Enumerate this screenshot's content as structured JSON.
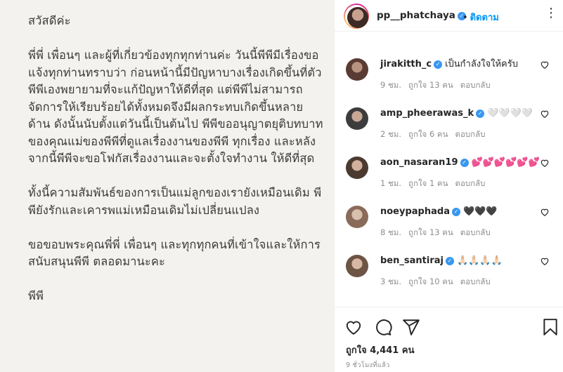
{
  "letter": {
    "paragraphs": [
      "สวัสดีค่ะ",
      "พี่พี่ เพื่อนๆ และผู้ที่เกี่ยวข้องทุกทุกท่านค่ะ วันนี้พีพีมีเรื่องขอแจ้งทุกท่านทราบว่า ก่อนหน้านี้มีปัญหาบางเรื่องเกิดขึ้นที่ตัวพีพีเองพยายามที่จะแก้ปัญหาให้ดีที่สุด แต่พีพีไม่สามารถจัดการให้เรียบร้อยได้ทั้งหมดจึงมีผลกระทบเกิดขึ้นหลายด้าน ดังนั้นนับตั้งแต่วันนี้เป็นต้นไป พีพีขออนุญาตยุติบทบาทของคุณแม่ของพีพีที่ดูแลเรื่องงานของพีพี ทุกเรื่อง และหลังจากนี้พีพีจะขอโฟกัสเรื่องงานและจะตั้งใจทำงาน ให้ดีที่สุด",
      "ทั้งนี้ความสัมพันธ์ของการเป็นแม่ลูกของเรายังเหมือนเดิม พีพียังรักและเคารพแม่เหมือนเดิมไม่เปลี่ยนแปลง",
      "ขอขอบพระคุณพี่พี่ เพื่อนๆ และทุกทุกคนที่เข้าใจและให้การสนับสนุนพีพี ตลอดมานะคะ",
      "พีพี"
    ]
  },
  "header": {
    "username": "pp__phatchaya",
    "verified_mark": "✓",
    "dot": "•",
    "follow_label": "ติดตาม",
    "more_icon": "⋮"
  },
  "comments": [
    {
      "username": "jirakitth_c",
      "verified": true,
      "text": "เป็นกำลังใจให้ครับ",
      "time": "9 ชม.",
      "likes": "ถูกใจ 13 คน",
      "reply": "ตอบกลับ",
      "avatar_color": "#5a3b33"
    },
    {
      "username": "amp_pheerawas_k",
      "verified": true,
      "text": "🤍🤍🤍🤍",
      "time": "2 ชม.",
      "likes": "ถูกใจ 6 คน",
      "reply": "ตอบกลับ",
      "avatar_color": "#3c3c3c"
    },
    {
      "username": "aon_nasaran19",
      "verified": true,
      "text": "💕💕💕💕💕💕",
      "time": "1 ชม.",
      "likes": "ถูกใจ 1 คน",
      "reply": "ตอบกลับ",
      "avatar_color": "#4a3a30"
    },
    {
      "username": "noeypaphada",
      "verified": true,
      "text": "🖤🖤🖤",
      "time": "8 ชม.",
      "likes": "ถูกใจ 13 คน",
      "reply": "ตอบกลับ",
      "avatar_color": "#8a6b5a"
    },
    {
      "username": "ben_santiraj",
      "verified": true,
      "text": "🙏🏻🙏🏻🙏🏻🙏🏻",
      "time": "3 ชม.",
      "likes": "ถูกใจ 10 คน",
      "reply": "ตอบกลับ",
      "avatar_color": "#6d5445"
    }
  ],
  "actions": {
    "likes_label": "ถูกใจ 4,441 คน",
    "time_ago": "9 ชั่วโมงที่แล้ว"
  },
  "colors": {
    "link_blue": "#0095f6",
    "verified_blue": "#3897f0",
    "meta_gray": "#8e8e8e",
    "letter_bg": "#f3f2ef"
  }
}
